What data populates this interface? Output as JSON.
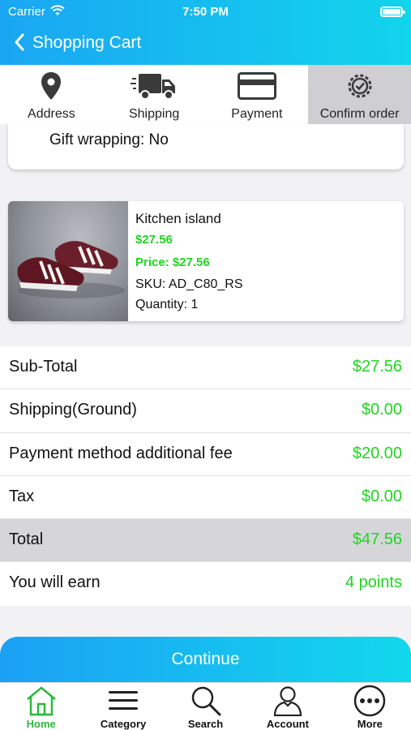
{
  "status_bar": {
    "carrier": "Carrier",
    "time": "7:50 PM"
  },
  "header": {
    "title": "Shopping Cart"
  },
  "steps": [
    {
      "label": "Address",
      "icon": "location-pin-icon"
    },
    {
      "label": "Shipping",
      "icon": "truck-icon"
    },
    {
      "label": "Payment",
      "icon": "credit-card-icon"
    },
    {
      "label": "Confirm order",
      "icon": "check-badge-icon",
      "active": true
    }
  ],
  "gift_wrapping": "Gift wrapping: No",
  "product": {
    "name": "Kitchen island",
    "price": "$27.56",
    "price_line": "Price: $27.56",
    "sku": "SKU: AD_C80_RS",
    "quantity": "Quantity: 1"
  },
  "totals": [
    {
      "label": "Sub-Total",
      "value": "$27.56"
    },
    {
      "label": "Shipping(Ground)",
      "value": "$0.00"
    },
    {
      "label": "Payment method additional fee",
      "value": "$20.00"
    },
    {
      "label": "Tax",
      "value": "$0.00"
    },
    {
      "label": "Total",
      "value": "$47.56"
    },
    {
      "label": "You will earn",
      "value": "4 points"
    }
  ],
  "continue_label": "Continue",
  "tabs": [
    {
      "label": "Home",
      "icon": "home-icon",
      "active": true
    },
    {
      "label": "Category",
      "icon": "menu-lines-icon"
    },
    {
      "label": "Search",
      "icon": "search-icon"
    },
    {
      "label": "Account",
      "icon": "user-icon"
    },
    {
      "label": "More",
      "icon": "more-dots-icon"
    }
  ],
  "colors": {
    "accent_green": "#1ed61e",
    "header_start": "#1aa6f2",
    "header_end": "#12d4ec",
    "tab_active": "#2db83d"
  }
}
